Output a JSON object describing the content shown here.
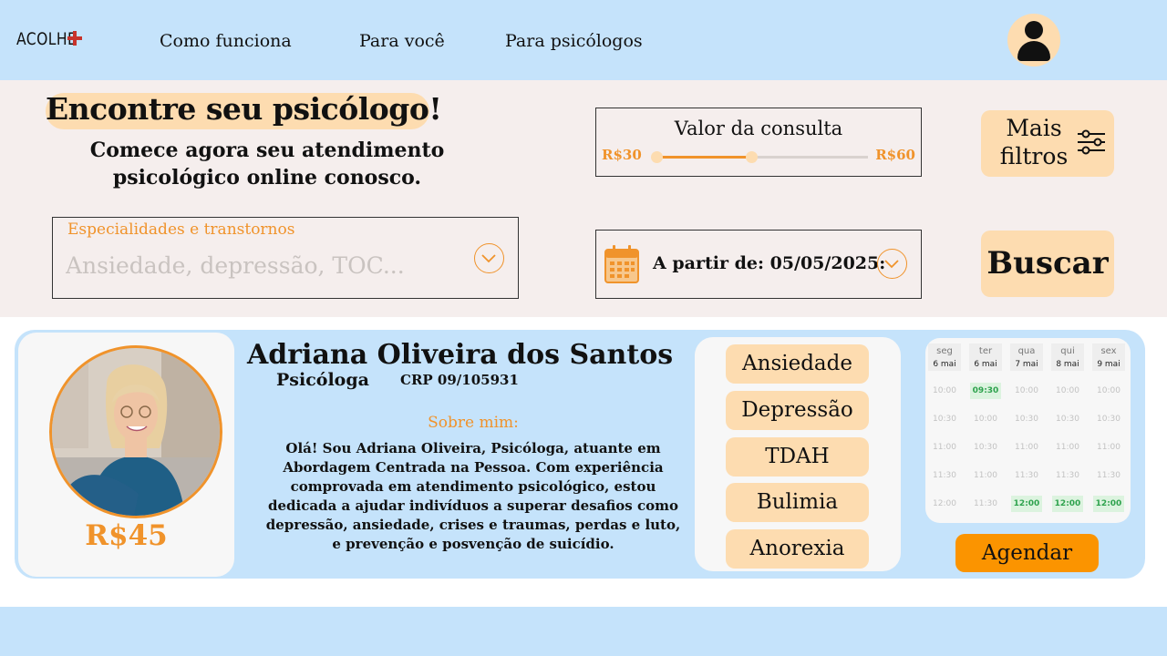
{
  "header": {
    "logo_text": "ACOLHE",
    "nav": [
      "Como funciona",
      "Para você",
      "Para psicólogos"
    ]
  },
  "search": {
    "title": "Encontre seu psicólogo!",
    "subtitle": "Comece agora seu atendimento psicológico online conosco.",
    "price": {
      "label": "Valor da consulta",
      "min_label": "R$30",
      "max_label": "R$60",
      "selected_min_fraction": 0.0,
      "selected_max_fraction": 0.45
    },
    "more_filters_label": "Mais filtros",
    "specialty": {
      "label": "Especialidades e transtornos",
      "placeholder": "Ansiedade, depressão, TOC...",
      "value": ""
    },
    "date_label": "A partir de: 05/05/2025:",
    "search_button": "Buscar"
  },
  "result": {
    "price": "R$45",
    "name": "Adriana Oliveira dos Santos",
    "role": "Psicóloga",
    "crp": "CRP 09/105931",
    "about_title": "Sobre mim:",
    "about_text": "Olá! Sou Adriana Oliveira, Psicóloga, atuante em Abordagem Centrada na Pessoa. Com experiência comprovada em atendimento psicológico, estou dedicada a ajudar indivíduos a superar desafios como depressão, ansiedade, crises e traumas, perdas e luto, e prevenção e posvenção de suicídio.",
    "tags": [
      "Ansiedade",
      "Depressão",
      "TDAH",
      "Bulimia",
      "Anorexia"
    ],
    "schedule": {
      "days": [
        {
          "name": "seg",
          "date": "6 mai",
          "slots": [
            {
              "time": "10:00",
              "available": false
            },
            {
              "time": "10:30",
              "available": false
            },
            {
              "time": "11:00",
              "available": false
            },
            {
              "time": "11:30",
              "available": false
            },
            {
              "time": "12:00",
              "available": false
            }
          ]
        },
        {
          "name": "ter",
          "date": "6 mai",
          "slots": [
            {
              "time": "09:30",
              "available": true
            },
            {
              "time": "10:00",
              "available": false
            },
            {
              "time": "10:30",
              "available": false
            },
            {
              "time": "11:00",
              "available": false
            },
            {
              "time": "11:30",
              "available": false
            }
          ]
        },
        {
          "name": "qua",
          "date": "7 mai",
          "slots": [
            {
              "time": "10:00",
              "available": false
            },
            {
              "time": "10:30",
              "available": false
            },
            {
              "time": "11:00",
              "available": false
            },
            {
              "time": "11:30",
              "available": false
            },
            {
              "time": "12:00",
              "available": true
            }
          ]
        },
        {
          "name": "qui",
          "date": "8 mai",
          "slots": [
            {
              "time": "10:00",
              "available": false
            },
            {
              "time": "10:30",
              "available": false
            },
            {
              "time": "11:00",
              "available": false
            },
            {
              "time": "11:30",
              "available": false
            },
            {
              "time": "12:00",
              "available": true
            }
          ]
        },
        {
          "name": "sex",
          "date": "9 mai",
          "slots": [
            {
              "time": "10:00",
              "available": false
            },
            {
              "time": "10:30",
              "available": false
            },
            {
              "time": "11:00",
              "available": false
            },
            {
              "time": "11:30",
              "available": false
            },
            {
              "time": "12:00",
              "available": true
            }
          ]
        }
      ]
    },
    "book_button": "Agendar"
  },
  "colors": {
    "header_bg": "#c5e3fb",
    "search_bg": "#f5eeed",
    "pill": "#fddcb0",
    "accent": "#f0932b",
    "book_button": "#fb9400",
    "available_slot": "#2ea24d",
    "logo_cross": "#c8332b"
  },
  "icons": [
    "plus-cross-icon",
    "user-avatar-icon",
    "sliders-filter-icon",
    "chevron-down-icon",
    "calendar-icon"
  ]
}
